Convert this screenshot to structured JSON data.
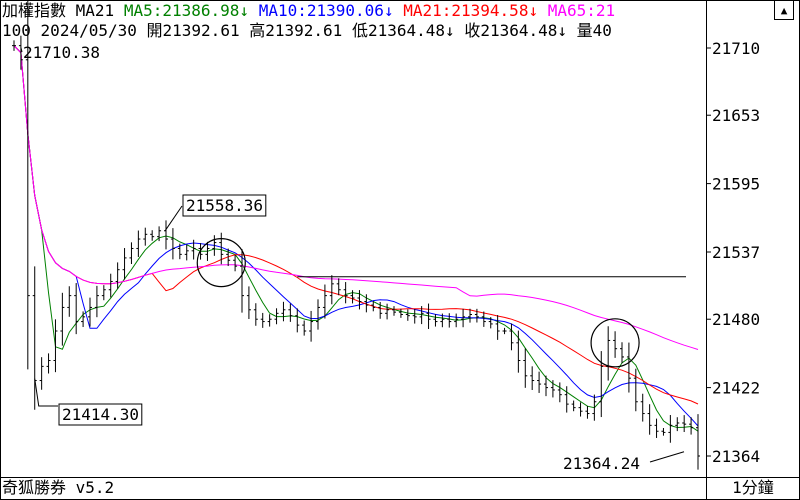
{
  "header": {
    "index_name": "加權指數",
    "indicator": "MA21",
    "ma": [
      {
        "label": "MA5:21386.98",
        "arrow": "↓",
        "color": "#008000"
      },
      {
        "label": "MA10:21390.06",
        "arrow": "↓",
        "color": "#0000ff"
      },
      {
        "label": "MA21:21394.58",
        "arrow": "↓",
        "color": "#ff0000"
      },
      {
        "label": "MA65:21",
        "arrow": "",
        "color": "#ff00ff"
      }
    ],
    "bar_count": "100",
    "date": "2024/05/30",
    "open": "開21392.61",
    "high": "高21392.61",
    "low": "低21364.48",
    "low_arrow": "↓",
    "close": "收21364.48",
    "close_arrow": "↓",
    "volume": "量40"
  },
  "scroll_icon": "triangle-up-icon",
  "price_axis": {
    "labels": [
      "21710",
      "21653",
      "21595",
      "21537",
      "21480",
      "21422",
      "21364"
    ]
  },
  "annotations": {
    "start_high": "21710.38",
    "peak": "21558.36",
    "low": "21414.30",
    "last_low": "21364.24"
  },
  "footer": {
    "app_name": "奇狐勝券 v5.2",
    "period": "1分鐘"
  },
  "chart_data": {
    "type": "candlestick",
    "bars": 100,
    "date": "2024/05/30",
    "ylim": [
      21345,
      21725
    ],
    "y_ticks": [
      21710,
      21653,
      21595,
      21537,
      21480,
      21422,
      21364
    ],
    "series": [
      {
        "name": "MA5",
        "color": "#008000"
      },
      {
        "name": "MA10",
        "color": "#0000ff"
      },
      {
        "name": "MA21",
        "color": "#ff0000"
      },
      {
        "name": "MA65",
        "color": "#ff00ff"
      }
    ],
    "close_path": [
      [
        0,
        21712
      ],
      [
        1,
        21700
      ],
      [
        2,
        21500
      ],
      [
        3,
        21428
      ],
      [
        4,
        21440
      ],
      [
        5,
        21445
      ],
      [
        6,
        21470
      ],
      [
        7,
        21490
      ],
      [
        8,
        21500
      ],
      [
        9,
        21478
      ],
      [
        10,
        21482
      ],
      [
        11,
        21490
      ],
      [
        12,
        21500
      ],
      [
        13,
        21505
      ],
      [
        14,
        21512
      ],
      [
        15,
        21522
      ],
      [
        16,
        21532
      ],
      [
        17,
        21540
      ],
      [
        18,
        21548
      ],
      [
        19,
        21552
      ],
      [
        20,
        21550
      ],
      [
        21,
        21555
      ],
      [
        22,
        21548
      ],
      [
        23,
        21540
      ],
      [
        24,
        21535
      ],
      [
        25,
        21538
      ],
      [
        26,
        21540
      ],
      [
        27,
        21535
      ],
      [
        28,
        21540
      ],
      [
        29,
        21545
      ],
      [
        30,
        21535
      ],
      [
        31,
        21530
      ],
      [
        32,
        21525
      ],
      [
        33,
        21500
      ],
      [
        34,
        21488
      ],
      [
        35,
        21480
      ],
      [
        36,
        21478
      ],
      [
        37,
        21480
      ],
      [
        38,
        21485
      ],
      [
        39,
        21488
      ],
      [
        40,
        21483
      ],
      [
        41,
        21475
      ],
      [
        42,
        21470
      ],
      [
        43,
        21478
      ],
      [
        44,
        21490
      ],
      [
        45,
        21500
      ],
      [
        46,
        21510
      ],
      [
        47,
        21505
      ],
      [
        48,
        21500
      ],
      [
        49,
        21498
      ],
      [
        50,
        21495
      ],
      [
        51,
        21492
      ],
      [
        52,
        21490
      ],
      [
        53,
        21485
      ],
      [
        54,
        21488
      ],
      [
        55,
        21486
      ],
      [
        56,
        21484
      ],
      [
        57,
        21483
      ],
      [
        58,
        21482
      ],
      [
        59,
        21485
      ],
      [
        60,
        21480
      ],
      [
        61,
        21478
      ],
      [
        62,
        21480
      ],
      [
        63,
        21478
      ],
      [
        64,
        21480
      ],
      [
        65,
        21482
      ],
      [
        66,
        21484
      ],
      [
        67,
        21482
      ],
      [
        68,
        21478
      ],
      [
        69,
        21476
      ],
      [
        70,
        21470
      ],
      [
        71,
        21470
      ],
      [
        72,
        21460
      ],
      [
        73,
        21445
      ],
      [
        74,
        21432
      ],
      [
        75,
        21428
      ],
      [
        76,
        21425
      ],
      [
        77,
        21422
      ],
      [
        78,
        21420
      ],
      [
        79,
        21416
      ],
      [
        80,
        21408
      ],
      [
        81,
        21405
      ],
      [
        82,
        21402
      ],
      [
        83,
        21400
      ],
      [
        84,
        21410
      ],
      [
        85,
        21440
      ],
      [
        86,
        21462
      ],
      [
        87,
        21455
      ],
      [
        88,
        21448
      ],
      [
        89,
        21430
      ],
      [
        90,
        21410
      ],
      [
        91,
        21400
      ],
      [
        92,
        21390
      ],
      [
        93,
        21385
      ],
      [
        94,
        21384
      ],
      [
        95,
        21390
      ],
      [
        96,
        21392
      ],
      [
        97,
        21391
      ],
      [
        98,
        21388
      ],
      [
        99,
        21364
      ]
    ],
    "annotations": [
      {
        "label": "21710.38",
        "bar": 1,
        "value": 21710.38
      },
      {
        "label": "21558.36",
        "bar": 21,
        "value": 21558.36
      },
      {
        "label": "21414.30",
        "bar": 3,
        "value": 21414.3
      },
      {
        "label": "21364.24",
        "bar": 99,
        "value": 21364.24
      }
    ],
    "hline": {
      "value": 21516,
      "from_bar": 41,
      "to_bar": 99
    },
    "circles": [
      {
        "bar": 30,
        "value": 21528
      },
      {
        "bar": 87,
        "value": 21460
      }
    ]
  }
}
